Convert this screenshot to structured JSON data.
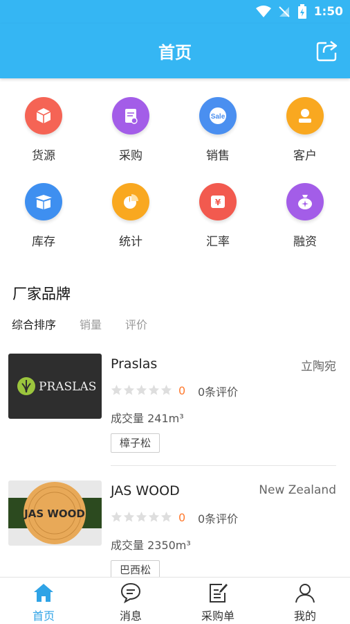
{
  "status_bar": {
    "time": "1:50"
  },
  "header": {
    "title": "首页"
  },
  "grid": [
    {
      "label": "货源",
      "icon": "box-icon",
      "color": "#f56455"
    },
    {
      "label": "采购",
      "icon": "purchase-doc-icon",
      "color": "#a35de8"
    },
    {
      "label": "销售",
      "icon": "sale-badge-icon",
      "color": "#4a8ff0"
    },
    {
      "label": "客户",
      "icon": "customer-icon",
      "color": "#f9a820"
    },
    {
      "label": "库存",
      "icon": "inventory-box-icon",
      "color": "#3e8ff0"
    },
    {
      "label": "统计",
      "icon": "pie-chart-icon",
      "color": "#f9a820"
    },
    {
      "label": "汇率",
      "icon": "yen-icon",
      "color": "#f25a4f"
    },
    {
      "label": "融资",
      "icon": "money-bag-icon",
      "color": "#a35de8"
    }
  ],
  "section": {
    "title": "厂家品牌",
    "sort_tabs": [
      "综合排序",
      "销量",
      "评价"
    ]
  },
  "brands": [
    {
      "name": "Praslas",
      "origin": "立陶宛",
      "logo_text": "PRASLAS",
      "rating": "0",
      "reviews": "0条评价",
      "volume": "成交量  241m³",
      "tag": "樟子松"
    },
    {
      "name": "JAS WOOD",
      "origin": "New Zealand",
      "logo_text": "JAS WOOD",
      "rating": "0",
      "reviews": "0条评价",
      "volume": "成交量  2350m³",
      "tag": "巴西松"
    }
  ],
  "bottom_nav": [
    {
      "label": "首页",
      "icon": "home-icon",
      "active": true
    },
    {
      "label": "消息",
      "icon": "chat-icon",
      "active": false
    },
    {
      "label": "采购单",
      "icon": "edit-list-icon",
      "active": false
    },
    {
      "label": "我的",
      "icon": "user-icon",
      "active": false
    }
  ],
  "colors": {
    "primary": "#35b6f3",
    "accent_orange": "#ff7a2f",
    "nav_active": "#2fa3e6"
  }
}
